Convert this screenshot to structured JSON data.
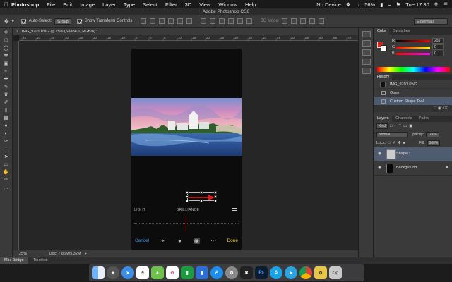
{
  "menubar": {
    "app_name": "Photoshop",
    "items": [
      "File",
      "Edit",
      "Image",
      "Layer",
      "Type",
      "Select",
      "Filter",
      "3D",
      "View",
      "Window",
      "Help"
    ],
    "device": "No Device",
    "battery": "56%",
    "clock": "Tue 17:30"
  },
  "window_title": "Adobe Photoshop CS6",
  "options": {
    "auto_select_label": "Auto-Select:",
    "auto_select_value": "Group",
    "show_transform_label": "Show Transform Controls",
    "mode_3d_label": "3D Mode:",
    "workspace": "Essentials"
  },
  "document": {
    "tab_title": "IMG_9701.PNG @ 25% (Shape 1, RGB/8) *",
    "zoom": "25%",
    "doc_size": "Doc: 7,85M/5,32M"
  },
  "ruler_ticks": [
    "45",
    "40",
    "35",
    "30",
    "25",
    "20",
    "15",
    "10",
    "5",
    "0",
    "5",
    "10",
    "15",
    "20",
    "25",
    "30",
    "35",
    "40",
    "45",
    "50",
    "55",
    "60",
    "65",
    "70"
  ],
  "phone_screen": {
    "left_label": "LIGHT",
    "center_label": "BRILLIANCE",
    "cancel": "Cancel",
    "done": "Done"
  },
  "bottom_tabs": [
    "Mini Bridge",
    "Timeline"
  ],
  "color_panel": {
    "tabs": [
      "Color",
      "Swatches"
    ],
    "r_label": "R",
    "r_value": "255",
    "g_label": "G",
    "g_value": "0",
    "b_label": "B",
    "b_value": "0",
    "foreground": "#e21b1b",
    "background": "#ffffff"
  },
  "history_panel": {
    "title": "History",
    "snapshot": "IMG_9701.PNG",
    "steps": [
      "Open",
      "Custom Shape Tool"
    ]
  },
  "layers_panel": {
    "tabs": [
      "Layers",
      "Channels",
      "Paths"
    ],
    "kind_label": "Kind",
    "blend_mode": "Normal",
    "opacity_label": "Opacity:",
    "opacity_value": "100%",
    "lock_label": "Lock:",
    "fill_label": "Fill:",
    "fill_value": "100%",
    "layers": [
      {
        "name": "Shape 1",
        "selected": true
      },
      {
        "name": "Background",
        "selected": false
      }
    ]
  },
  "dock_apps": [
    "finder-icon",
    "launchpad-icon",
    "safari-icon",
    "calendar-icon",
    "maps-icon",
    "photos-icon",
    "numbers-icon",
    "keynote-icon",
    "app-store-icon",
    "system-preferences-icon",
    "x-icon",
    "photoshop-icon",
    "skype-icon",
    "telegram-icon",
    "chrome-icon",
    "utility-icon",
    "trash-icon"
  ],
  "dock_calendar_day": "4",
  "dock_photoshop_label": "Ps"
}
